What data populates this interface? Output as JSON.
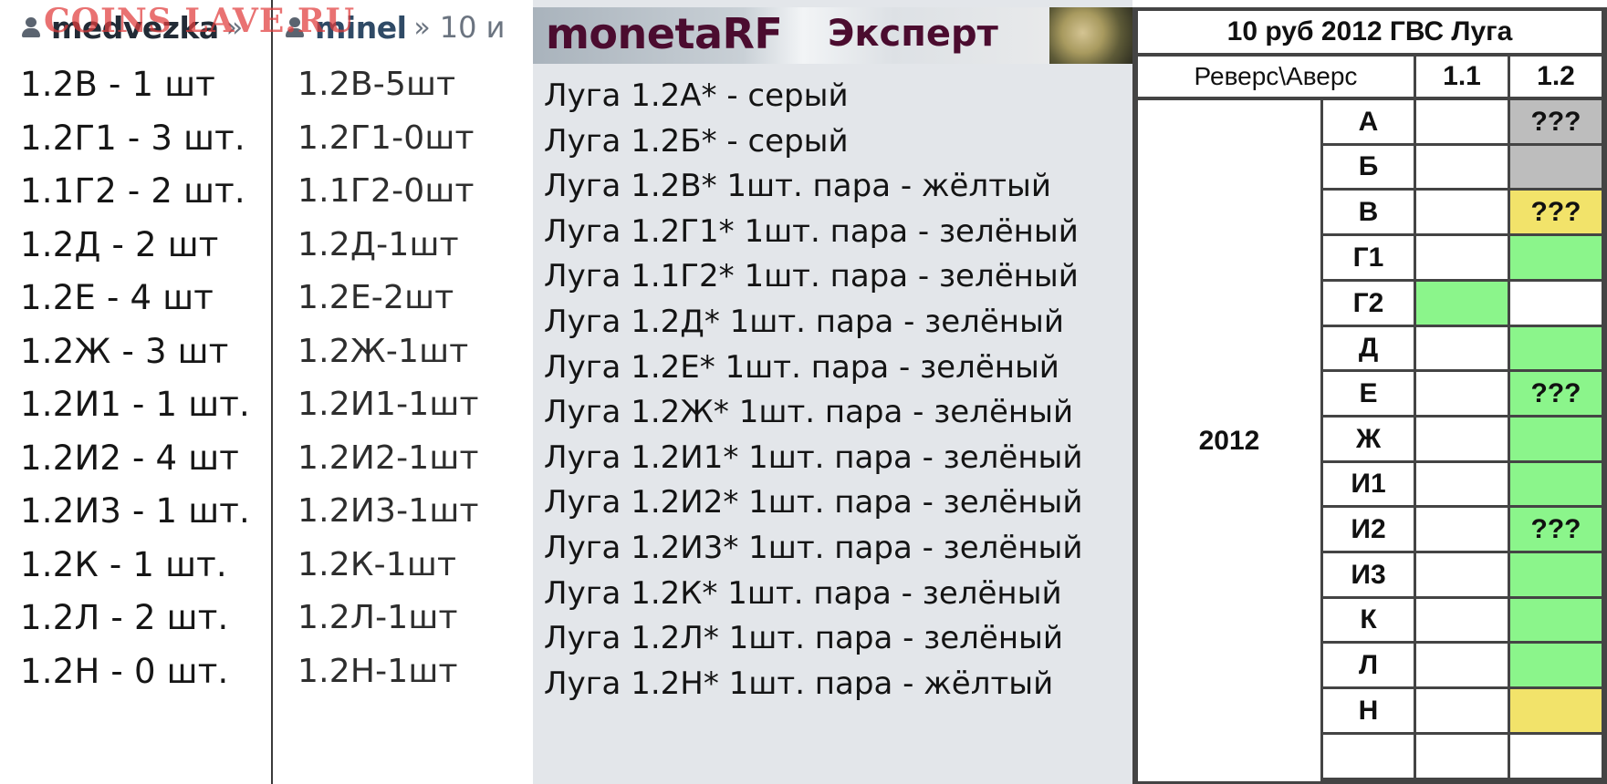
{
  "watermark": "COINS LAVE.RU",
  "panel1": {
    "user": "medvezka",
    "sep": "»",
    "items": [
      "1.2В - 1 шт",
      "1.2Г1 - 3 шт.",
      "1.1Г2 - 2 шт.",
      "1.2Д - 2 шт",
      "1.2Е - 4 шт",
      "1.2Ж - 3 шт",
      "1.2И1 - 1 шт.",
      "1.2И2 - 4 шт",
      "1.2И3 - 1 шт.",
      "1.2К - 1 шт.",
      "1.2Л - 2 шт.",
      "1.2Н - 0 шт."
    ]
  },
  "panel2": {
    "user": "minel",
    "sep": "»",
    "crumb": "10 и",
    "items": [
      "1.2В-5шт",
      "1.2Г1-0шт",
      "1.1Г2-0шт",
      "1.2Д-1шт",
      "1.2Е-2шт",
      "1.2Ж-1шт",
      "1.2И1-1шт",
      "1.2И2-1шт",
      "1.2И3-1шт",
      "1.2К-1шт",
      "1.2Л-1шт",
      "1.2Н-1шт"
    ]
  },
  "panel3": {
    "brand": "monetaRF",
    "tag": "Эксперт",
    "items": [
      "Луга 1.2А* - серый",
      "Луга 1.2Б* - серый",
      "Луга 1.2В* 1шт. пара - жёлтый",
      "Луга 1.2Г1* 1шт. пара - зелёный",
      "Луга 1.1Г2* 1шт. пара - зелёный",
      "Луга 1.2Д* 1шт. пара - зелёный",
      "Луга 1.2Е* 1шт. пара - зелёный",
      "Луга 1.2Ж* 1шт. пара - зелёный",
      "Луга 1.2И1* 1шт. пара - зелёный",
      "Луга 1.2И2* 1шт. пара - зелёный",
      "Луга 1.2И3* 1шт. пара - зелёный",
      "Луга 1.2К* 1шт. пара - зелёный",
      "Луга 1.2Л* 1шт. пара - зелёный",
      "Луга 1.2Н* 1шт. пара - жёлтый"
    ]
  },
  "table": {
    "title": "10 руб 2012 ГВС Луга",
    "header_label": "Реверс\\Аверс",
    "col1": "1.1",
    "col2": "1.2",
    "year": "2012",
    "rows": [
      {
        "label": "А",
        "v1": "",
        "v2": "???",
        "c1": "white",
        "c2": "gray"
      },
      {
        "label": "Б",
        "v1": "",
        "v2": "",
        "c1": "white",
        "c2": "gray"
      },
      {
        "label": "В",
        "v1": "",
        "v2": "???",
        "c1": "white",
        "c2": "yellow"
      },
      {
        "label": "Г1",
        "v1": "",
        "v2": "",
        "c1": "white",
        "c2": "green"
      },
      {
        "label": "Г2",
        "v1": "",
        "v2": "",
        "c1": "green",
        "c2": "white"
      },
      {
        "label": "Д",
        "v1": "",
        "v2": "",
        "c1": "white",
        "c2": "green"
      },
      {
        "label": "Е",
        "v1": "",
        "v2": "???",
        "c1": "white",
        "c2": "green"
      },
      {
        "label": "Ж",
        "v1": "",
        "v2": "",
        "c1": "white",
        "c2": "green"
      },
      {
        "label": "И1",
        "v1": "",
        "v2": "",
        "c1": "white",
        "c2": "green"
      },
      {
        "label": "И2",
        "v1": "",
        "v2": "???",
        "c1": "white",
        "c2": "green"
      },
      {
        "label": "И3",
        "v1": "",
        "v2": "",
        "c1": "white",
        "c2": "green"
      },
      {
        "label": "К",
        "v1": "",
        "v2": "",
        "c1": "white",
        "c2": "green"
      },
      {
        "label": "Л",
        "v1": "",
        "v2": "",
        "c1": "white",
        "c2": "green"
      },
      {
        "label": "Н",
        "v1": "",
        "v2": "",
        "c1": "white",
        "c2": "yellow"
      },
      {
        "label": "",
        "v1": "",
        "v2": "",
        "c1": "white",
        "c2": "white"
      }
    ]
  },
  "colors": {
    "gray": "#bdbdbd",
    "green": "#8bf58b",
    "yellow": "#f2e36a",
    "brand": "#4b0c2f",
    "watermark": "#e13c3c"
  }
}
